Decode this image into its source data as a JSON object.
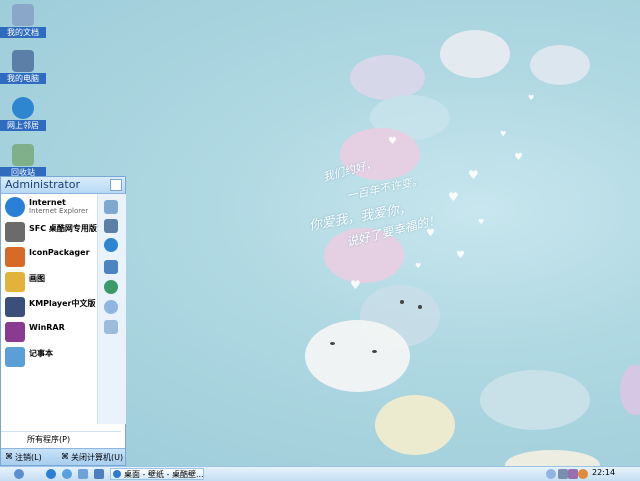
{
  "desktop": {
    "icons": [
      {
        "label": "我的文档",
        "icon": "my-documents-icon",
        "color": "#8aa7c9"
      },
      {
        "label": "我的电脑",
        "icon": "my-computer-icon",
        "color": "#5c7fa7"
      },
      {
        "label": "网上邻居",
        "icon": "network-icon",
        "color": "#2e86d0"
      },
      {
        "label": "回收站",
        "icon": "recycle-bin-icon",
        "color": "#7fb08a"
      }
    ],
    "wallpaper_text": [
      "我们约好，",
      "一百年不许变。",
      "你爱我，我爱你，",
      "说好了要幸福的！"
    ]
  },
  "start_menu": {
    "user": "Administrator",
    "pinned": [
      {
        "title": "Internet",
        "subtitle": "Internet Explorer",
        "icon": "internet-explorer-icon",
        "color": "#2a7fd6"
      },
      {
        "title": "SFC 桌酷网专用版",
        "subtitle": "",
        "icon": "sfc-icon",
        "color": "#6b6b6b"
      },
      {
        "title": "IconPackager",
        "subtitle": "",
        "icon": "iconpackager-icon",
        "color": "#d76a27"
      },
      {
        "title": "画图",
        "subtitle": "",
        "icon": "paint-icon",
        "color": "#e2b23a"
      },
      {
        "title": "KMPlayer中文版",
        "subtitle": "",
        "icon": "kmplayer-icon",
        "color": "#3a4f7a"
      },
      {
        "title": "WinRAR",
        "subtitle": "",
        "icon": "winrar-icon",
        "color": "#8a3b8f"
      },
      {
        "title": "记事本",
        "subtitle": "",
        "icon": "notepad-icon",
        "color": "#5c9fd6"
      }
    ],
    "right_icons": [
      "folder-icon",
      "computer-icon",
      "internet-icon",
      "control-panel-icon",
      "globe-icon",
      "search-icon",
      "run-icon"
    ],
    "all_programs": "所有程序(P)",
    "logoff": "注销(L)",
    "shutdown": "关闭计算机(U)"
  },
  "taskbar": {
    "task_label": "桌面 - 壁纸 - 桌酷壁...",
    "clock": "22:14"
  },
  "colors": {
    "accent": "#2f6cc0",
    "menu_border": "#7ba7d6"
  }
}
